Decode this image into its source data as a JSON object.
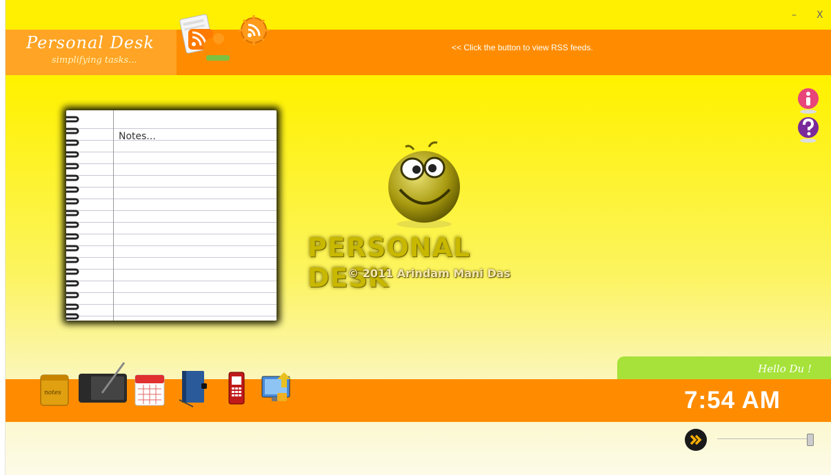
{
  "window": {
    "minimize_label": "–",
    "close_label": "X"
  },
  "header": {
    "title": "Personal Desk",
    "subtitle": "simplifying tasks...",
    "rss_hint": "<< Click the button to view RSS feeds.",
    "feed_reader_icon": "feed-reader-icon",
    "rss_button_icon": "rss-icon"
  },
  "notebook": {
    "placeholder_text": "Notes..."
  },
  "logo": {
    "title": "PERSONAL DESK",
    "copyright": "© 2011 Arindam Mani Das",
    "mascot": "smiley-face-icon"
  },
  "side_buttons": [
    {
      "icon": "info-icon"
    },
    {
      "icon": "help-icon"
    }
  ],
  "dock": [
    {
      "icon": "notes-icon"
    },
    {
      "icon": "drawing-tablet-icon"
    },
    {
      "icon": "calendar-icon"
    },
    {
      "icon": "address-book-icon"
    },
    {
      "icon": "mobile-phone-icon"
    },
    {
      "icon": "lock-screen-icon"
    }
  ],
  "status": {
    "greeting": "Hello Du !",
    "time": "7:54 AM"
  },
  "colors": {
    "accent_orange": "#ff8c00",
    "background_yellow": "#ffef00",
    "greeting_green": "#a6e23a"
  },
  "slider": {
    "level": 1.0
  }
}
